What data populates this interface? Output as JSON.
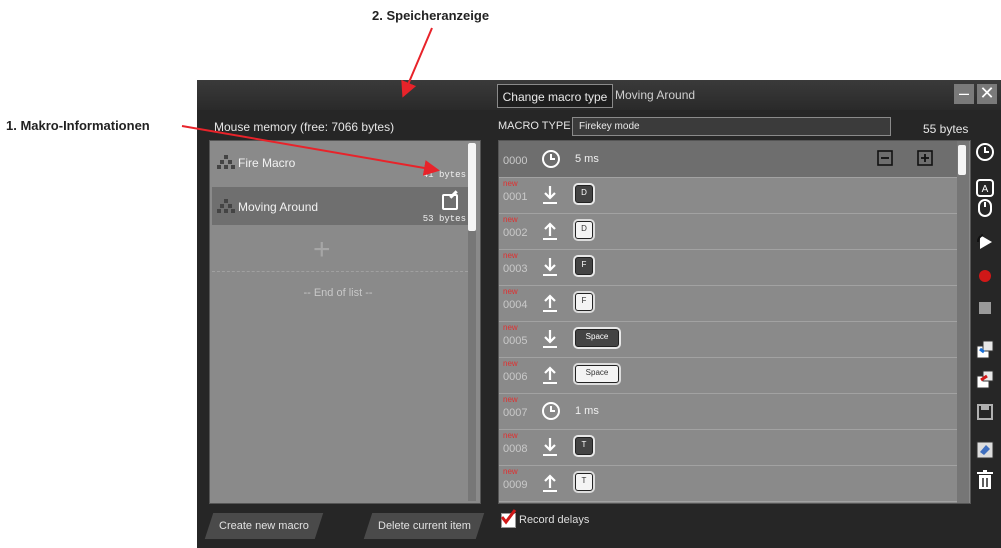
{
  "annotations": {
    "top": "2. Speicheranzeige",
    "left": "1. Makro-Informationen"
  },
  "window": {
    "title": "Moving Around",
    "tooltip": "Change macro type",
    "minimize": "–",
    "close": "✕"
  },
  "left_panel": {
    "memory_label": "Mouse memory (free: 7066 bytes)",
    "macros": [
      {
        "name": "Fire Macro",
        "bytes": "41 bytes"
      },
      {
        "name": "Moving Around",
        "bytes": "53 bytes"
      }
    ],
    "add": "+",
    "end_of_list": "-- End of list --",
    "create_button": "Create new macro",
    "delete_button": "Delete current item"
  },
  "right_panel": {
    "macro_type_label": "MACRO TYPE",
    "macro_type_value": "Firekey mode",
    "size": "55 bytes",
    "record_delays": "Record delays",
    "steps": [
      {
        "num": "0000",
        "new": "",
        "kind": "delay",
        "text": "5 ms"
      },
      {
        "num": "0001",
        "new": "new",
        "kind": "down",
        "text": "D"
      },
      {
        "num": "0002",
        "new": "new",
        "kind": "up",
        "text": "D"
      },
      {
        "num": "0003",
        "new": "new",
        "kind": "down",
        "text": "F"
      },
      {
        "num": "0004",
        "new": "new",
        "kind": "up",
        "text": "F"
      },
      {
        "num": "0005",
        "new": "new",
        "kind": "down",
        "text": "Space"
      },
      {
        "num": "0006",
        "new": "new",
        "kind": "up",
        "text": "Space"
      },
      {
        "num": "0007",
        "new": "new",
        "kind": "delay",
        "text": "1 ms"
      },
      {
        "num": "0008",
        "new": "new",
        "kind": "down",
        "text": "T"
      },
      {
        "num": "0009",
        "new": "new",
        "kind": "up",
        "text": "T"
      }
    ]
  },
  "colors": {
    "annotation_arrow": "#e8232a",
    "record_button": "#d01818"
  }
}
